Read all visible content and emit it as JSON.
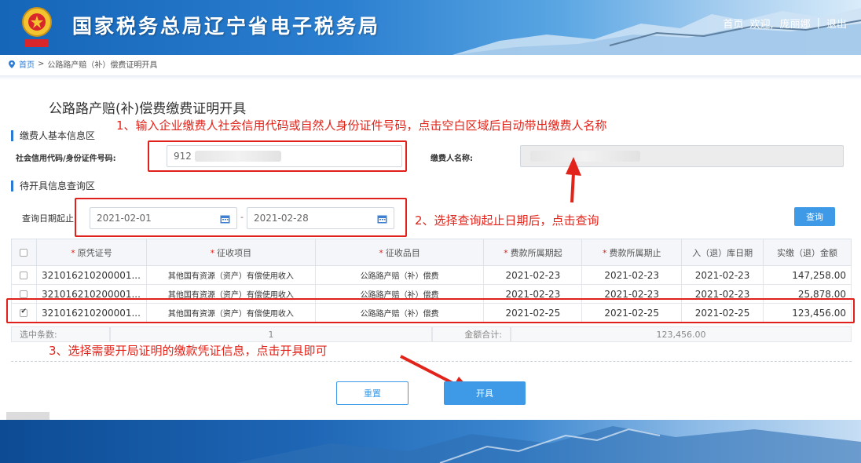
{
  "header": {
    "site_title": "国家税务总局辽宁省电子税务局",
    "nav_home": "首页",
    "nav_welcome": "欢迎,",
    "nav_user": "庞丽娜",
    "nav_sep": "|",
    "nav_logout": "退出"
  },
  "breadcrumb": {
    "home": "首页",
    "sep": ">",
    "current": "公路路产赔（补）偿费证明开具"
  },
  "page_title": "公路路产赔(补)偿费缴费证明开具",
  "sections": {
    "payer_info": "缴费人基本信息区",
    "query_info": "待开具信息查询区"
  },
  "annotations": {
    "step1": "1、输入企业缴费人社会信用代码或自然人身份证件号码，点击空白区域后自动带出缴费人名称",
    "step2": "2、选择查询起止日期后，点击查询",
    "step3": "3、选择需要开局证明的缴款凭证信息，点击开具即可"
  },
  "form": {
    "id_label": "社会信用代码/身份证件号码:",
    "id_value": "912",
    "name_label": "缴费人名称:",
    "date_label": "查询日期起止:",
    "date_start": "2021-02-01",
    "date_sep": "-",
    "date_end": "2021-02-28",
    "query_button": "查询"
  },
  "table": {
    "headers": [
      "原凭证号",
      "征收项目",
      "征收品目",
      "费款所属期起",
      "费款所属期止",
      "入（退）库日期",
      "实缴（退）金额"
    ],
    "required_mark": "*",
    "rows": [
      {
        "voucher": "321016210200001...",
        "item": "其他国有资源（资产）有偿使用收入",
        "sub_item": "公路路产赔（补）偿费",
        "period_start": "2021-02-23",
        "period_end": "2021-02-23",
        "date": "2021-02-23",
        "amount": "147,258.00",
        "checked": false
      },
      {
        "voucher": "321016210200001...",
        "item": "其他国有资源（资产）有偿使用收入",
        "sub_item": "公路路产赔（补）偿费",
        "period_start": "2021-02-23",
        "period_end": "2021-02-23",
        "date": "2021-02-23",
        "amount": "25,878.00",
        "checked": false
      },
      {
        "voucher": "321016210200001...",
        "item": "其他国有资源（资产）有偿使用收入",
        "sub_item": "公路路产赔（补）偿费",
        "period_start": "2021-02-25",
        "period_end": "2021-02-25",
        "date": "2021-02-25",
        "amount": "123,456.00",
        "checked": true
      }
    ]
  },
  "summary": {
    "selected_label": "选中条数:",
    "selected_count": "1",
    "total_label": "金额合计:",
    "total_amount": "123,456.00"
  },
  "buttons": {
    "reset": "重置",
    "open": "开具"
  },
  "colors": {
    "accent": "#3e9ae6",
    "annotation_red": "#e2231a"
  }
}
